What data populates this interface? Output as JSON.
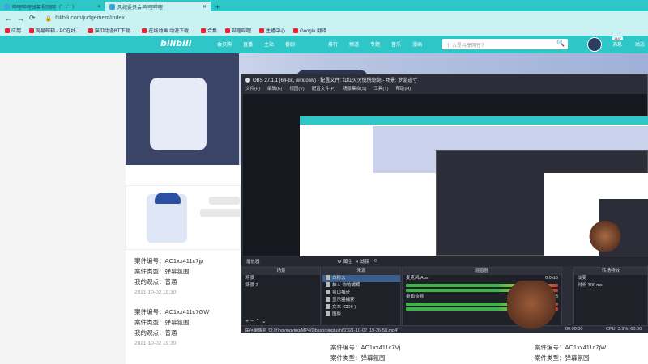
{
  "browser": {
    "tabs": [
      {
        "label": "哔哩哔哩弹幕视频网（゜-゜）",
        "active": false
      },
      {
        "label": "风纪委员会-哔哩哔哩",
        "active": true
      }
    ],
    "new_tab": "+",
    "url": "bilibili.com/judgement/index",
    "bookmarks": [
      "应用",
      "网易邮箱 - PC在线...",
      "猫爪动漫BT下载...",
      "在线动画 动漫下载...",
      "合集",
      "哔哩哔哩",
      "主播中心",
      "Google 翻译"
    ]
  },
  "site": {
    "logo": "bilibili",
    "nav": [
      "会员购",
      "直播",
      "主站",
      "番剧"
    ],
    "nav2": [
      "排行",
      "频道",
      "专题",
      "音乐",
      "漫画"
    ],
    "search_placeholder": "什么是共享网仔?",
    "search_icon": "🔍",
    "badge": "1457",
    "messages": "消息",
    "activity": "动态"
  },
  "cases": [
    {
      "id_label": "案件编号：",
      "id": "AC1xx411c7jp",
      "type_label": "案件类型：",
      "type": "弹幕氛围",
      "opinion_label": "我的观点：",
      "opinion": "普通",
      "time": "2021-10-02 19:30"
    },
    {
      "id_label": "案件编号：",
      "id": "AC1xx411c7GW",
      "type_label": "案件类型：",
      "type": "弹幕氛围",
      "opinion_label": "我的观点：",
      "opinion": "普通",
      "time": "2021-10-02 19:30"
    },
    {
      "id_label": "案件编号：",
      "id": "AC1xx411c7Vj",
      "type_label": "案件类型：",
      "type": "弹幕氛围"
    },
    {
      "id_label": "案件编号：",
      "id": "AC1xx411c7jW",
      "type_label": "案件类型：",
      "type": "弹幕氛围"
    }
  ],
  "obs": {
    "title": "OBS 27.1.1 (64-bit, windows) - 配置文件: 红红火火恍恍惚惚 - 场景: 梦游道寸",
    "menu": [
      "文件(F)",
      "编辑(E)",
      "视图(V)",
      "配置文件(P)",
      "场景集合(S)",
      "工具(T)",
      "帮助(H)"
    ],
    "preview_bar": [
      "播放器",
      "属性",
      "滤镜"
    ],
    "scenes_header": "场景",
    "scenes": [
      "场景",
      "场景 2"
    ],
    "sources_header": "来源",
    "sources": [
      "白粉大",
      "神人 你的蝴蝶",
      "窗口捕获",
      "显示器捕获",
      "文本 (GDI+)",
      "图像"
    ],
    "mixer_header": "混音器",
    "mixer": [
      {
        "name": "麦克风/Aux",
        "db": "0.0 dB"
      },
      {
        "name": "桌面音频",
        "db": "0.0 dB"
      }
    ],
    "transitions_header": "转场特效",
    "transition_value": "淡变",
    "duration_label": "时长",
    "duration": "300 ms",
    "status_left": "保存录像到 'D:/Yingyingying/MP4/Obsshipinglushi/2021-10-02_19-26-58.mp4'",
    "status_time": "00:00:00",
    "status_cpu": "CPU: 3.9%, 60.00"
  }
}
